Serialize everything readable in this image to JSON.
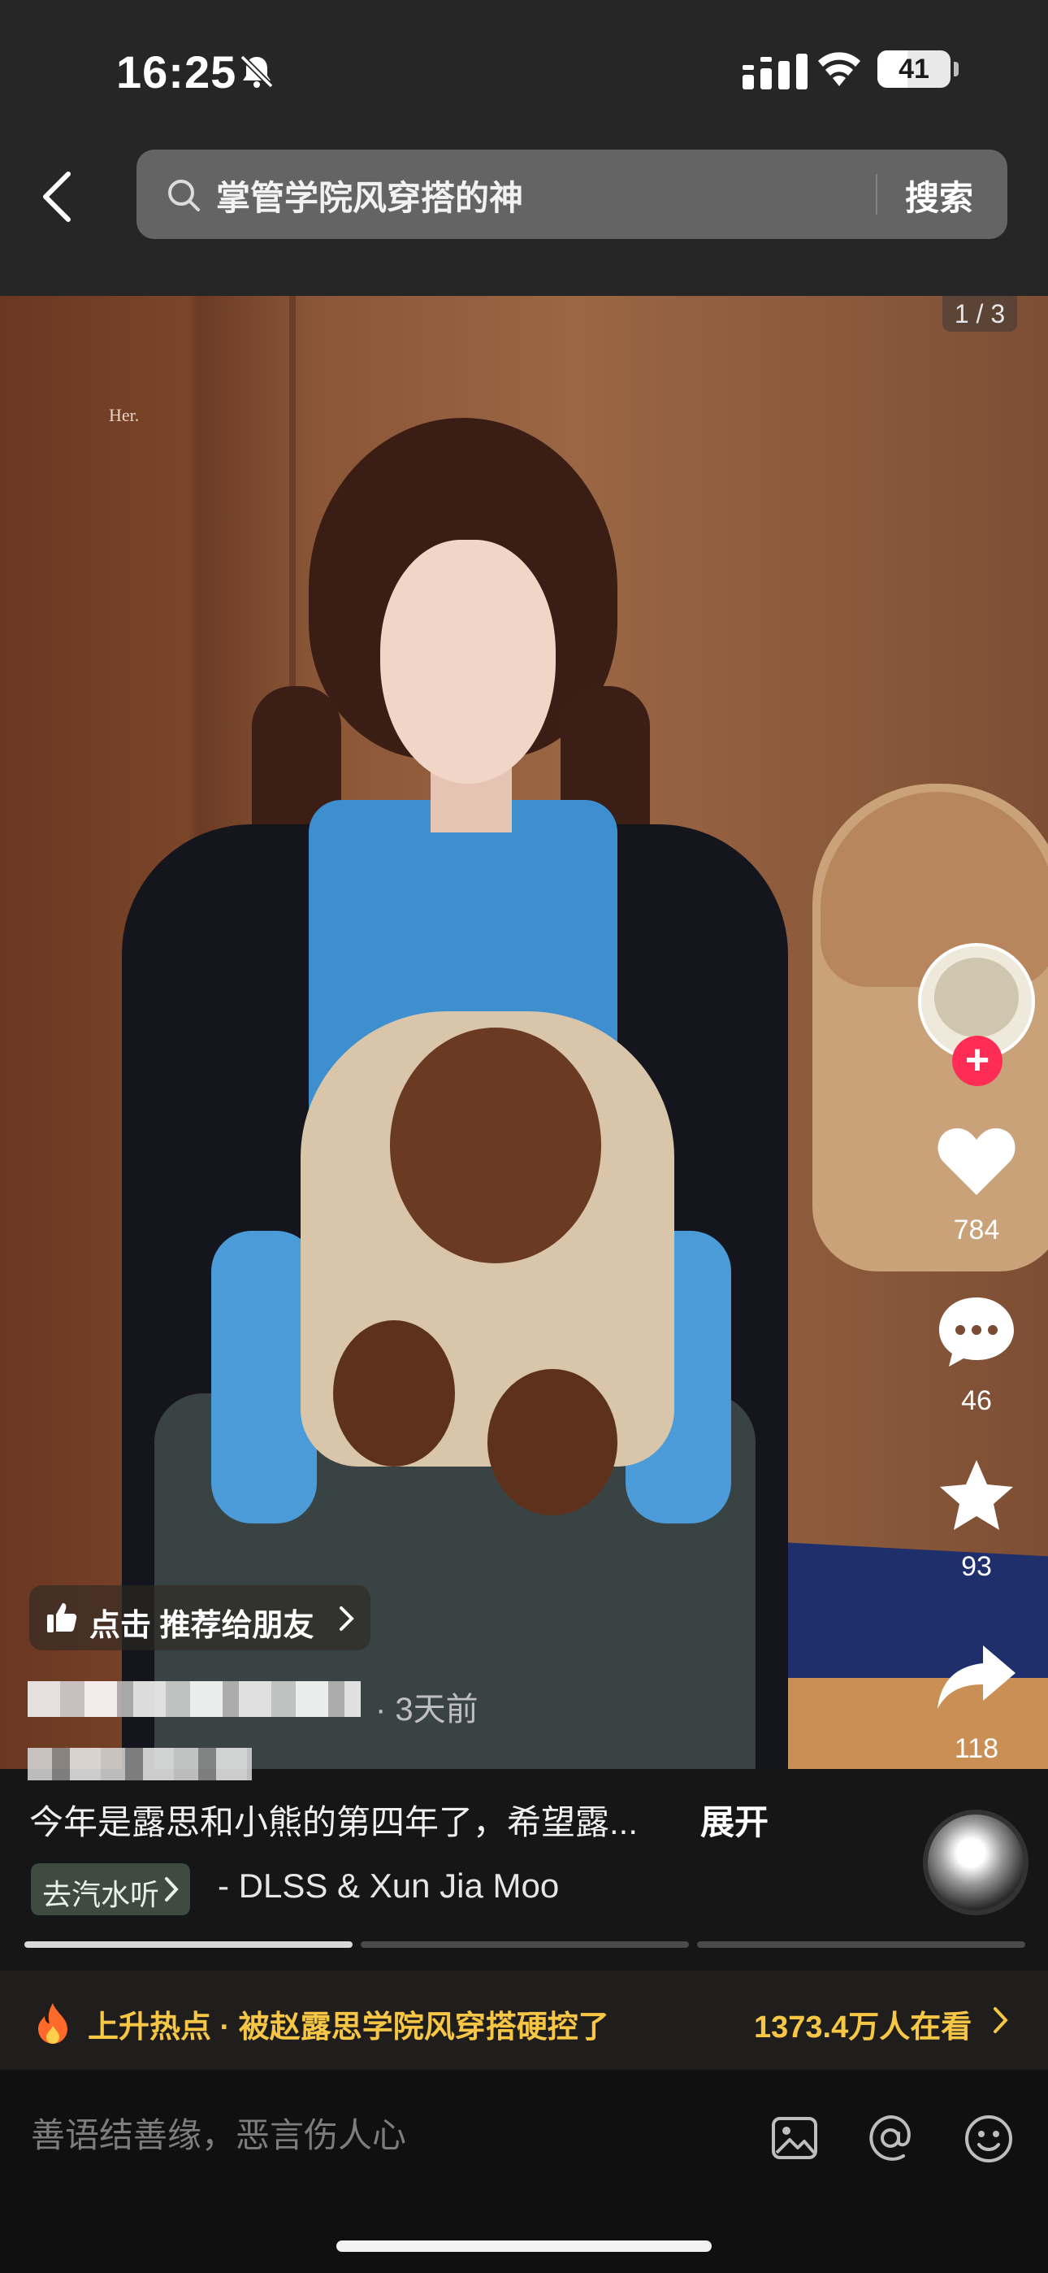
{
  "status_bar": {
    "time": "16:25",
    "battery": "41",
    "battery_level": 0.41
  },
  "search": {
    "query": "掌管学院风穿搭的神",
    "button_label": "搜索"
  },
  "post": {
    "page_counter": "1 / 3",
    "image_watermark": "Her.",
    "recommend_label": "点击 推荐给朋友",
    "time_ago": "· 3天前",
    "caption": "今年是露思和小熊的第四年了，希望露...",
    "expand_label": "展开",
    "music_chip_label": "去汽水听",
    "music_title": "- DLSS & Xun Jia     Moo"
  },
  "actions": {
    "likes": "784",
    "comments": "46",
    "favorites": "93",
    "shares": "118",
    "follow_symbol": "+"
  },
  "hot_topic": {
    "label": "上升热点 · 被赵露思学院风穿搭硬控了",
    "viewers": "1373.4万人在看"
  },
  "comment_box": {
    "placeholder": "善语结善缘，恶言伤人心"
  },
  "colors": {
    "accent_red": "#ff2d55",
    "hot_yellow": "#f6c644",
    "background": "#161616"
  }
}
